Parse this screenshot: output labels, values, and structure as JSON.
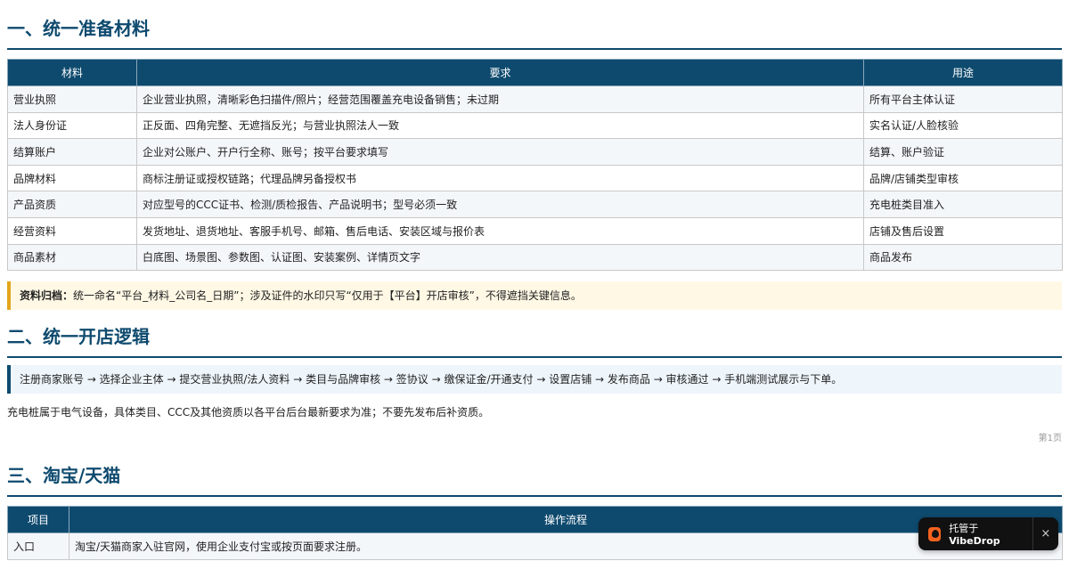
{
  "sections": {
    "s1": {
      "title": "一、统一准备材料",
      "headers": [
        "材料",
        "要求",
        "用途"
      ],
      "rows": [
        [
          "营业执照",
          "企业营业执照，清晰彩色扫描件/照片；经营范围覆盖充电设备销售；未过期",
          "所有平台主体认证"
        ],
        [
          "法人身份证",
          "正反面、四角完整、无遮挡反光；与营业执照法人一致",
          "实名认证/人脸核验"
        ],
        [
          "结算账户",
          "企业对公账户、开户行全称、账号；按平台要求填写",
          "结算、账户验证"
        ],
        [
          "品牌材料",
          "商标注册证或授权链路；代理品牌另备授权书",
          "品牌/店铺类型审核"
        ],
        [
          "产品资质",
          "对应型号的CCC证书、检测/质检报告、产品说明书；型号必须一致",
          "充电桩类目准入"
        ],
        [
          "经营资料",
          "发货地址、退货地址、客服手机号、邮箱、售后电话、安装区域与报价表",
          "店铺及售后设置"
        ],
        [
          "商品素材",
          "白底图、场景图、参数图、认证图、安装案例、详情页文字",
          "商品发布"
        ]
      ],
      "note_label": "资料归档：",
      "note_text": "统一命名“平台_材料_公司名_日期”；涉及证件的水印只写“仅用于【平台】开店审核”，不得遮挡关键信息。"
    },
    "s2": {
      "title": "二、统一开店逻辑",
      "flow": "注册商家账号 → 选择企业主体 → 提交营业执照/法人资料 → 类目与品牌审核 → 签协议 → 缴保证金/开通支付 → 设置店铺 → 发布商品 → 审核通过 → 手机端测试展示与下单。",
      "text": "充电桩属于电气设备，具体类目、CCC及其他资质以各平台后台最新要求为准；不要先发布后补资质。"
    },
    "page_number": "第1页",
    "s3": {
      "title": "三、淘宝/天猫",
      "headers": [
        "项目",
        "操作流程"
      ],
      "rows": [
        [
          "入口",
          "淘宝/天猫商家入驻官网，使用企业支付宝或按页面要求注册。"
        ]
      ]
    }
  },
  "badge": {
    "prefix": "托管于",
    "brand": "VibeDrop",
    "close": "×"
  }
}
